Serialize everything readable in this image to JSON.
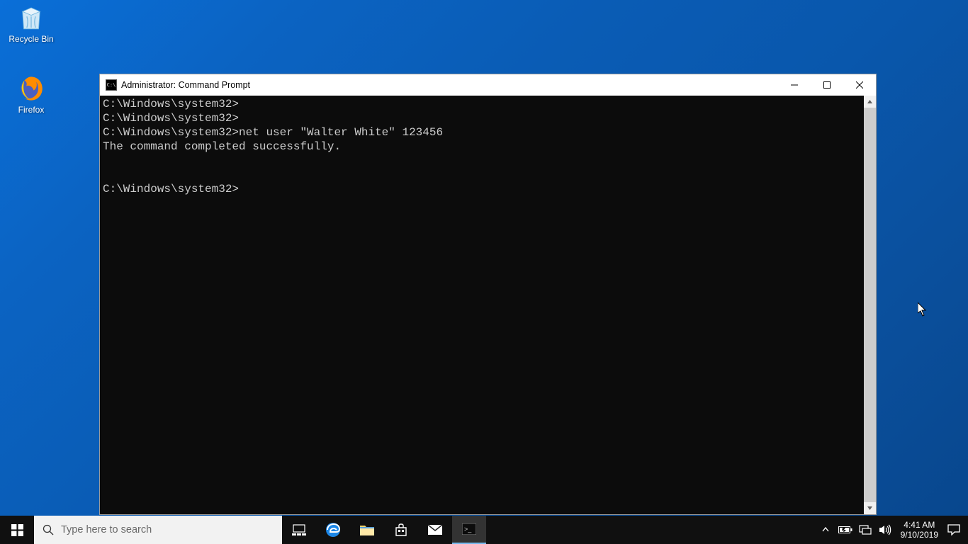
{
  "desktop": {
    "icons": [
      {
        "name": "recycle-bin",
        "label": "Recycle Bin"
      },
      {
        "name": "firefox",
        "label": "Firefox"
      }
    ]
  },
  "window": {
    "title": "Administrator: Command Prompt",
    "terminal_lines": "C:\\Windows\\system32>\nC:\\Windows\\system32>\nC:\\Windows\\system32>net user \"Walter White\" 123456\nThe command completed successfully.\n\n\nC:\\Windows\\system32>"
  },
  "taskbar": {
    "search_placeholder": "Type here to search",
    "clock": {
      "time": "4:41 AM",
      "date": "9/10/2019"
    }
  }
}
